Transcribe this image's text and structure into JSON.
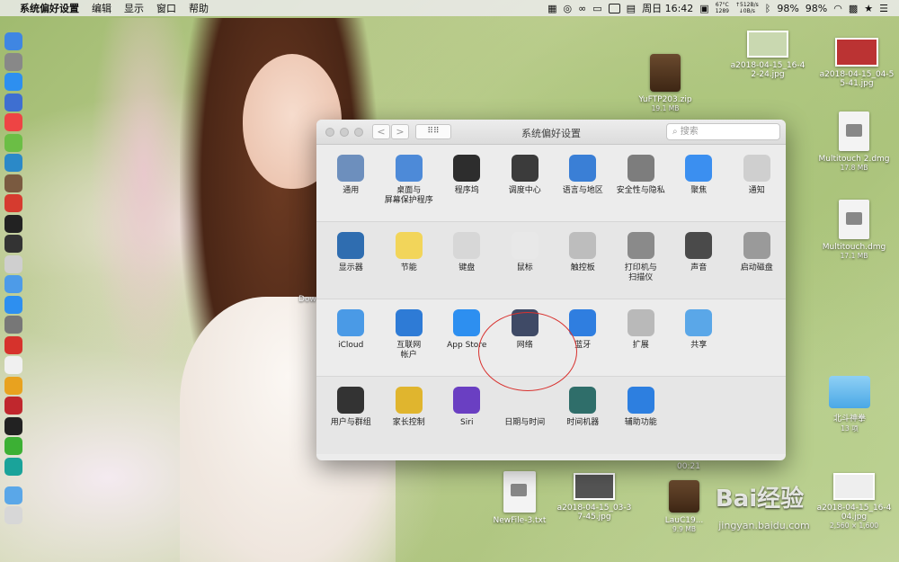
{
  "menubar": {
    "app_name": "系统偏好设置",
    "menus": [
      "编辑",
      "显示",
      "窗口",
      "帮助"
    ],
    "cpu_temp": "67°C",
    "cpu_rpm": "1289",
    "net_up": "↑512B/s",
    "net_down": "↓0B/s",
    "clock": "周日 16:42",
    "battery1": "98%",
    "battery2": "98%"
  },
  "window": {
    "title": "系统偏好设置",
    "back_glyph": "<",
    "forward_glyph": ">",
    "grid_glyph": "⠿⠿",
    "search_placeholder": "搜索",
    "rows": [
      [
        {
          "label": "通用",
          "icon": "general-icon",
          "color": "#6d8fbd"
        },
        {
          "label": "桌面与\n屏幕保护程序",
          "icon": "desktop-screensaver-icon",
          "color": "#4d8ad8"
        },
        {
          "label": "程序坞",
          "icon": "dock-icon",
          "color": "#2d2d2d"
        },
        {
          "label": "调度中心",
          "icon": "mission-control-icon",
          "color": "#3b3b3b"
        },
        {
          "label": "语言与地区",
          "icon": "language-region-icon",
          "color": "#3a7fd6"
        },
        {
          "label": "安全性与隐私",
          "icon": "security-privacy-icon",
          "color": "#7d7d7d"
        },
        {
          "label": "聚焦",
          "icon": "spotlight-icon",
          "color": "#3b8ff0"
        },
        {
          "label": "通知",
          "icon": "notifications-icon",
          "color": "#cfcfcf"
        }
      ],
      [
        {
          "label": "显示器",
          "icon": "displays-icon",
          "color": "#2f6db0"
        },
        {
          "label": "节能",
          "icon": "energy-saver-icon",
          "color": "#f2d55a"
        },
        {
          "label": "键盘",
          "icon": "keyboard-icon",
          "color": "#d7d7d7"
        },
        {
          "label": "鼠标",
          "icon": "mouse-icon",
          "color": "#e8e8e8"
        },
        {
          "label": "触控板",
          "icon": "trackpad-icon",
          "color": "#bdbdbd"
        },
        {
          "label": "打印机与\n扫描仪",
          "icon": "printer-icon",
          "color": "#8a8a8a"
        },
        {
          "label": "声音",
          "icon": "sound-icon",
          "color": "#4a4a4a"
        },
        {
          "label": "启动磁盘",
          "icon": "startup-disk-icon",
          "color": "#9a9a9a"
        }
      ],
      [
        {
          "label": "iCloud",
          "icon": "icloud-icon",
          "color": "#4a9ae6"
        },
        {
          "label": "互联网\n帐户",
          "icon": "internet-accounts-icon",
          "color": "#2e7bd6"
        },
        {
          "label": "App Store",
          "icon": "app-store-icon",
          "color": "#2d8ff0"
        },
        {
          "label": "网络",
          "icon": "network-icon",
          "color": "#3f4a66"
        },
        {
          "label": "蓝牙",
          "icon": "bluetooth-icon",
          "color": "#2f7ee0"
        },
        {
          "label": "扩展",
          "icon": "extensions-icon",
          "color": "#b9b9b9"
        },
        {
          "label": "共享",
          "icon": "sharing-icon",
          "color": "#5aa7e8"
        }
      ],
      [
        {
          "label": "用户与群组",
          "icon": "users-groups-icon",
          "color": "#333333"
        },
        {
          "label": "家长控制",
          "icon": "parental-controls-icon",
          "color": "#e0b52e"
        },
        {
          "label": "Siri",
          "icon": "siri-icon",
          "color": "#6a3fc2"
        },
        {
          "label": "日期与时间",
          "icon": "date-time-icon",
          "color": "#e6e6e6"
        },
        {
          "label": "时间机器",
          "icon": "time-machine-icon",
          "color": "#2f6e6a"
        },
        {
          "label": "辅助功能",
          "icon": "accessibility-icon",
          "color": "#2d7fe0"
        }
      ]
    ]
  },
  "desktop": {
    "items": [
      {
        "name": "a2018-04-15_16-4\n2-24.jpg",
        "sub": ""
      },
      {
        "name": "a2018-04-15_04-5\n5-41.jpg",
        "sub": ""
      },
      {
        "name": "YuFTP203.zip",
        "sub": "19.1 MB"
      },
      {
        "name": "Multitouch 2.dmg",
        "sub": "17.8 MB"
      },
      {
        "name": "Multitouch.dmg",
        "sub": "17.1 MB"
      },
      {
        "name": "北斗神拳",
        "sub": "13 项"
      },
      {
        "name": "NewFile-3.txt",
        "sub": ""
      },
      {
        "name": "a2018-04-15_03-3\n7-45.jpg",
        "sub": ""
      },
      {
        "name": "LauC19...",
        "sub": "9.9 MB"
      },
      {
        "name": "a2018-04-15_16-4\n04.jpg",
        "sub": "2,560 × 1,600"
      }
    ],
    "partial_label": "Dow",
    "video_time": "00:21",
    "watermark": "Bai经验",
    "watermark_url": "jingyan.baidu.com"
  }
}
